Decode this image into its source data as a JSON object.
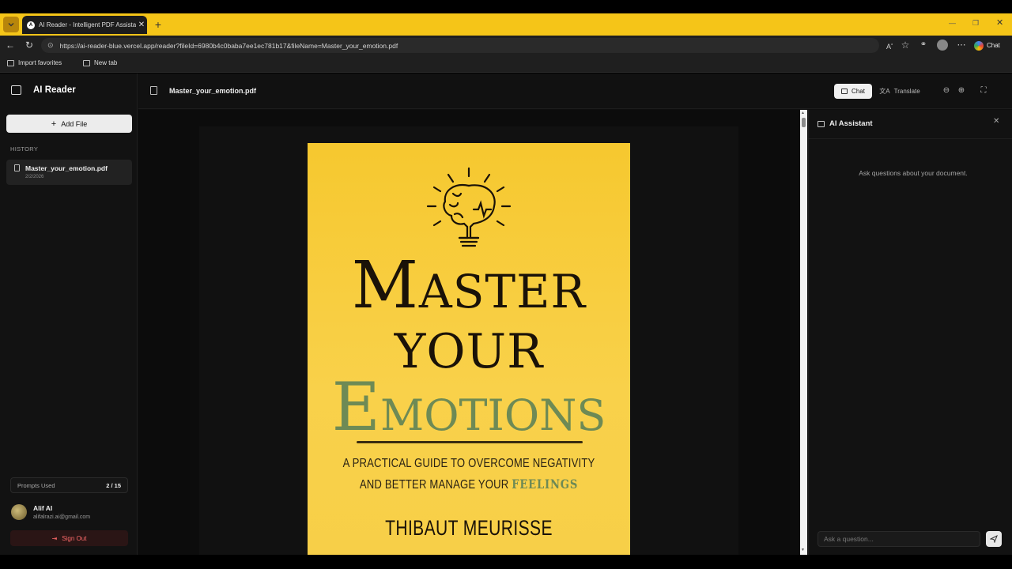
{
  "browser": {
    "tab_title": "AI Reader - Intelligent PDF Assista",
    "tab_favicon": "A",
    "url": "https://ai-reader-blue.vercel.app/reader?fileId=6980b4c0baba7ee1ec781b17&fileName=Master_your_emotion.pdf",
    "chat_label": "Chat",
    "favorites": [
      "Import favorites",
      "New tab"
    ],
    "accent_color": "#f5c518"
  },
  "sidebar": {
    "brand": "AI Reader",
    "add_file_label": "Add File",
    "history_label": "HISTORY",
    "history": [
      {
        "name": "Master_your_emotion.pdf",
        "date": "2/2/2026"
      }
    ],
    "prompts_label": "Prompts Used",
    "prompts_value": "2 / 15",
    "user": {
      "name": "Alif AI",
      "email": "alifalrazi.ai@gmail.com"
    },
    "signout_label": "Sign Out"
  },
  "viewer": {
    "filename": "Master_your_emotion.pdf",
    "chat_toggle": "Chat",
    "translate_toggle": "Translate"
  },
  "cover": {
    "title_line1_big": "M",
    "title_line1_rest": "ASTER",
    "title_line2": "YOUR",
    "title_line3_big": "E",
    "title_line3_rest": "MOTIONS",
    "subtitle_line1": "A PRACTICAL GUIDE TO OVERCOME NEGATIVITY",
    "subtitle_line2_a": "AND BETTER MANAGE YOUR ",
    "subtitle_line2_b": "FEELINGS",
    "author": "THIBAUT MEURISSE",
    "bg_color": "#f7ca35",
    "green": "#6e8a55"
  },
  "assistant": {
    "title": "AI Assistant",
    "empty_text": "Ask questions about your document.",
    "input_placeholder": "Ask a question..."
  }
}
